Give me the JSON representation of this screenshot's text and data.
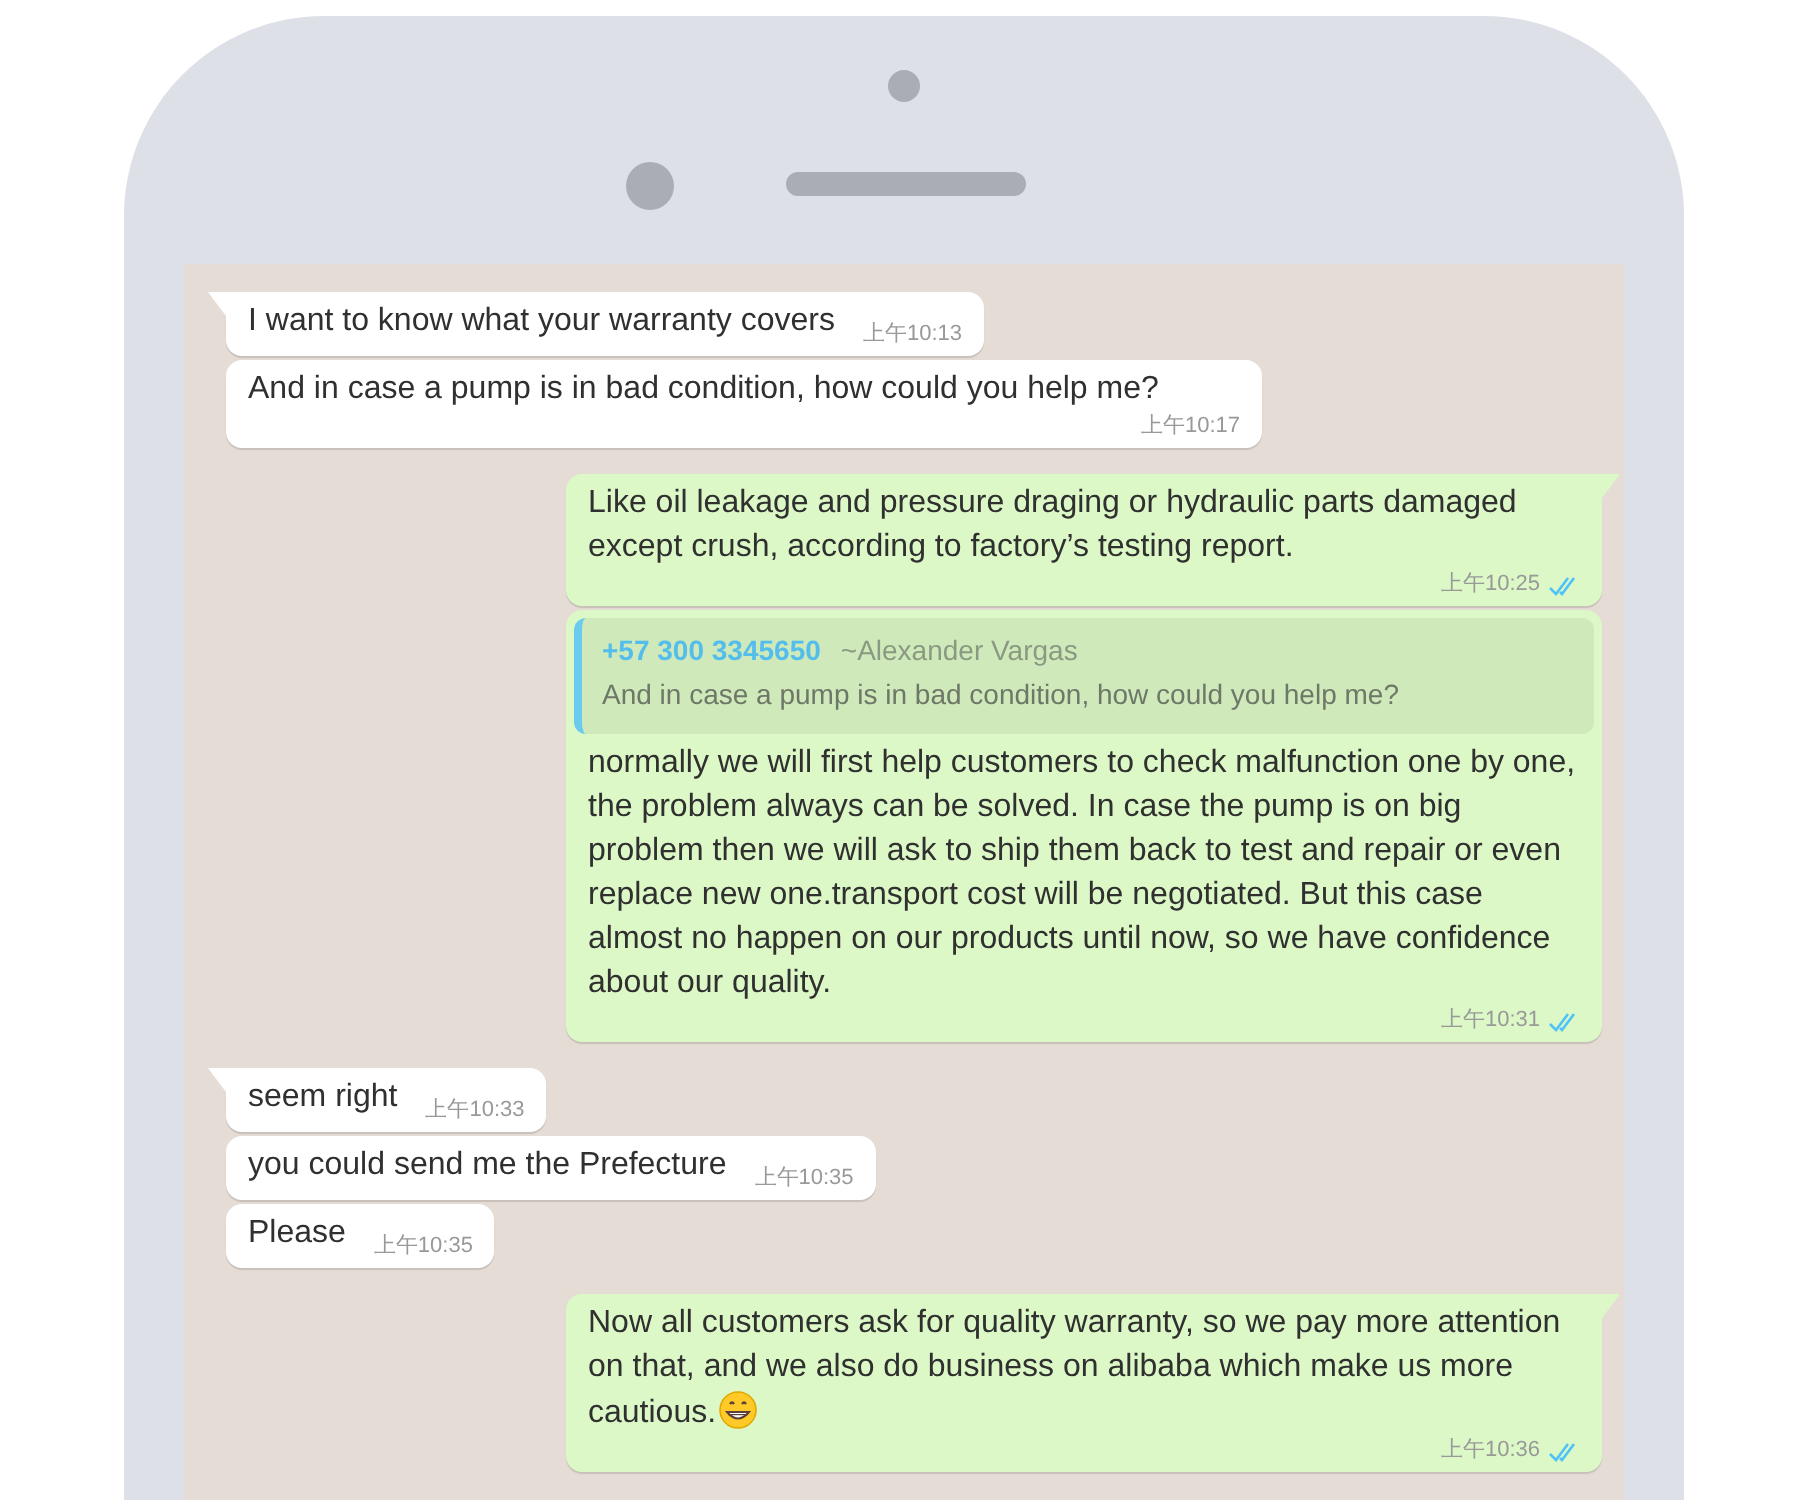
{
  "messages": [
    {
      "kind": "incoming",
      "tail": true,
      "text": "I want to know what your warranty covers",
      "time": "上午10:13"
    },
    {
      "kind": "incoming",
      "tail": false,
      "text": "And in case a pump is in bad condition, how could you help me?",
      "time": "上午10:17"
    },
    {
      "kind": "outgoing",
      "tail": true,
      "text": "Like oil leakage and pressure draging or hydraulic parts damaged except crush, according to factory’s testing report.",
      "time": "上午10:25",
      "read": true
    },
    {
      "kind": "outgoing",
      "tail": false,
      "quote": {
        "phone": "+57 300 3345650",
        "name": "~Alexander Vargas",
        "text": "And in case a pump is in bad condition, how could you help me?"
      },
      "text": "normally we will first help customers to check malfunction one by one, the problem always can be solved. In case the pump is on big problem then we will ask to ship them back to test and repair or even replace new one.transport cost will be negotiated. But this case almost no happen on our products until now, so we have confidence about our quality.",
      "time": "上午10:31",
      "read": true
    },
    {
      "kind": "incoming",
      "tail": true,
      "text": "seem right",
      "time": "上午10:33"
    },
    {
      "kind": "incoming",
      "tail": false,
      "text": "you could send me the Prefecture",
      "time": "上午10:35"
    },
    {
      "kind": "incoming",
      "tail": false,
      "text": "Please",
      "time": "上午10:35"
    },
    {
      "kind": "outgoing",
      "tail": true,
      "text": "Now all customers ask for quality warranty, so we pay more attention on that, and we also do business on alibaba which make us more cautious.",
      "emoji": true,
      "time": "上午10:36",
      "read": true
    }
  ]
}
